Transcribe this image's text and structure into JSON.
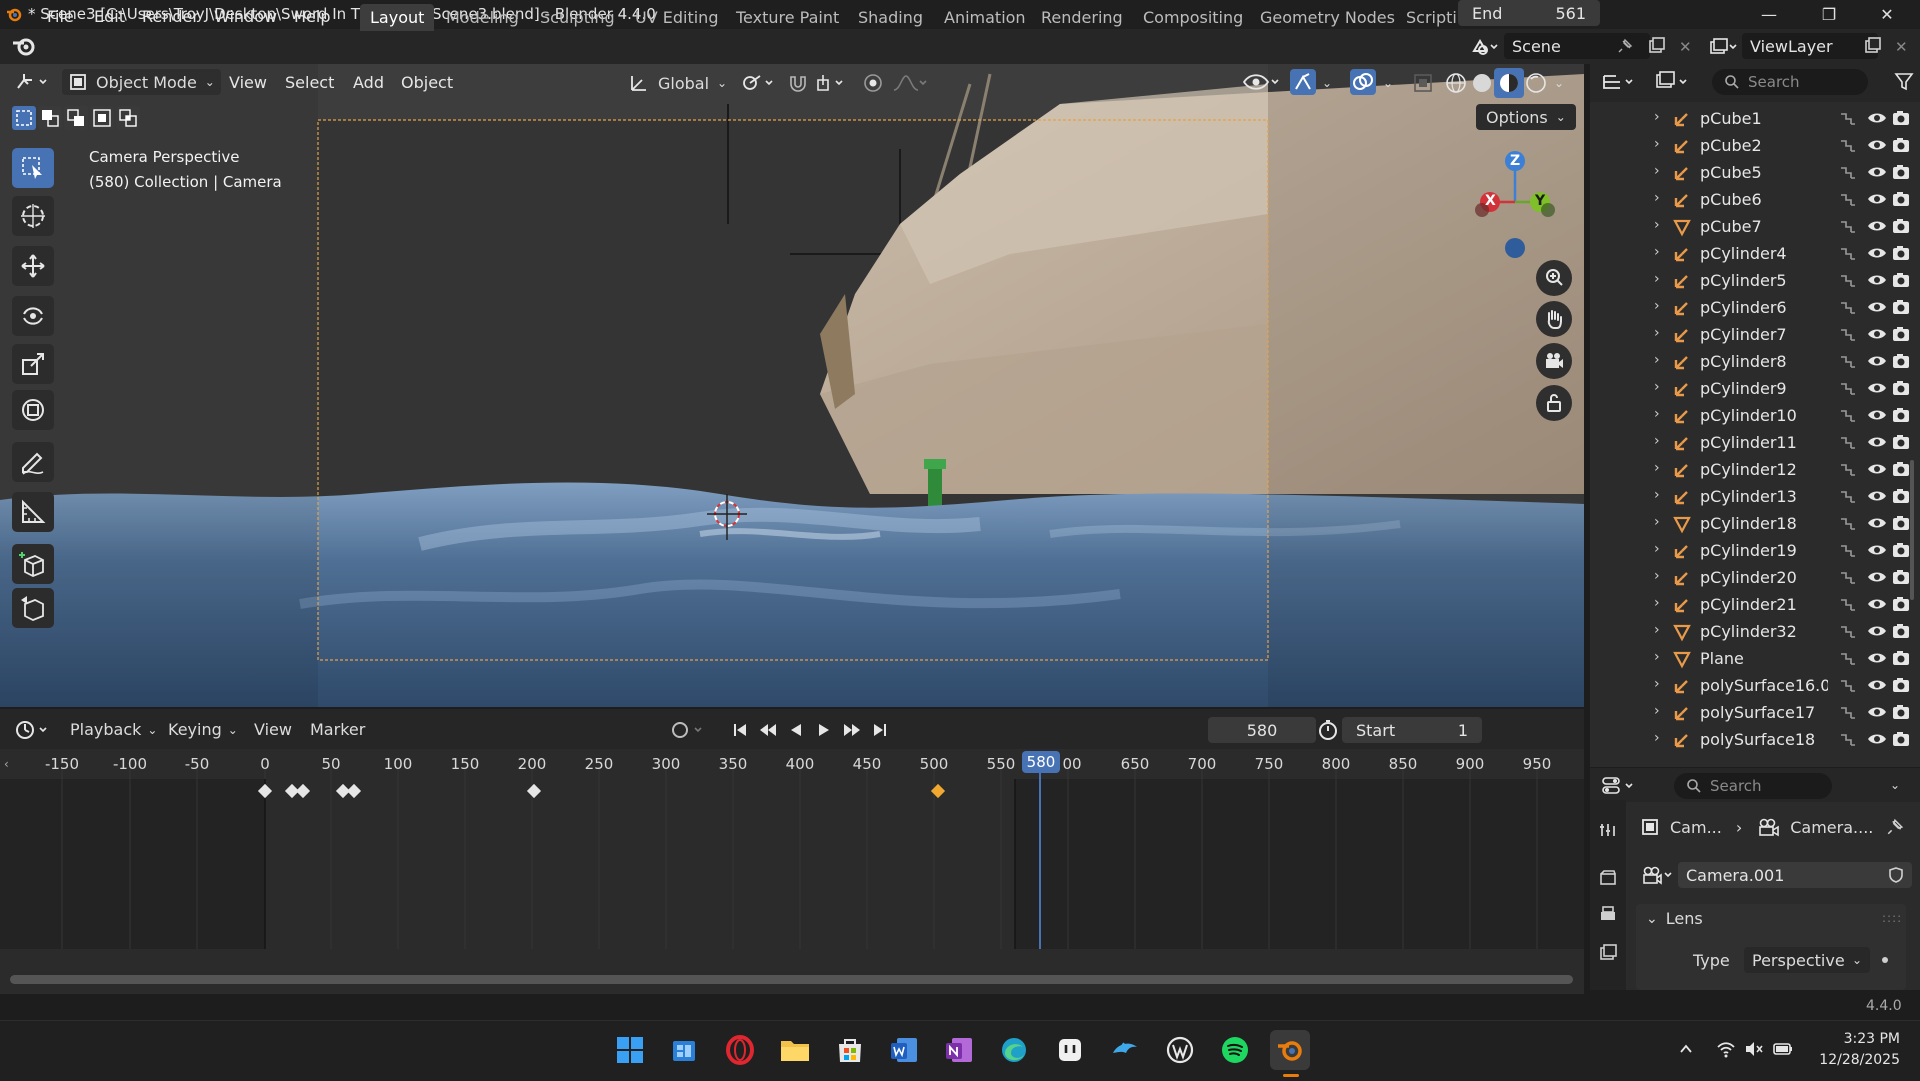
{
  "titlebar": {
    "title": "* Scene3 [C:\\Users\\TroyJ\\Desktop\\Sword In The Stone\\Scene3.blend] - Blender 4.4.0"
  },
  "menu": {
    "file": "File",
    "edit": "Edit",
    "render": "Render",
    "window": "Window",
    "help": "Help"
  },
  "workspaces": [
    {
      "label": "Layout"
    },
    {
      "label": "Modeling"
    },
    {
      "label": "Sculpting"
    },
    {
      "label": "UV Editing"
    },
    {
      "label": "Texture Paint"
    },
    {
      "label": "Shading"
    },
    {
      "label": "Animation"
    },
    {
      "label": "Rendering"
    },
    {
      "label": "Compositing"
    },
    {
      "label": "Geometry Nodes"
    },
    {
      "label": "Scripti"
    }
  ],
  "scene": {
    "name": "Scene",
    "view_layer": "ViewLayer"
  },
  "viewport": {
    "mode": "Object Mode",
    "menus": {
      "view": "View",
      "select": "Select",
      "add": "Add",
      "object": "Object"
    },
    "transform_orientation": "Global",
    "options": "Options",
    "overlay_line1": "Camera Perspective",
    "overlay_line2": "(580) Collection | Camera",
    "gizmo": {
      "x": "X",
      "y": "Y",
      "z": "Z"
    }
  },
  "timeline": {
    "menus": {
      "playback": "Playback",
      "keying": "Keying",
      "view": "View",
      "marker": "Marker"
    },
    "current_frame": "580",
    "start_label": "Start",
    "start_value": "1",
    "end_label": "End",
    "end_value": "561",
    "ticks": [
      "-150",
      "-100",
      "-50",
      "0",
      "50",
      "100",
      "150",
      "200",
      "250",
      "300",
      "350",
      "400",
      "450",
      "500",
      "550",
      "00",
      "650",
      "700",
      "750",
      "800",
      "850",
      "900",
      "950"
    ],
    "playhead_label": "580"
  },
  "outliner": {
    "search_placeholder": "Search",
    "items": [
      {
        "name": "pCube1",
        "kind": "empty"
      },
      {
        "name": "pCube2",
        "kind": "empty"
      },
      {
        "name": "pCube5",
        "kind": "empty"
      },
      {
        "name": "pCube6",
        "kind": "empty"
      },
      {
        "name": "pCube7",
        "kind": "mesh"
      },
      {
        "name": "pCylinder4",
        "kind": "empty"
      },
      {
        "name": "pCylinder5",
        "kind": "empty"
      },
      {
        "name": "pCylinder6",
        "kind": "empty"
      },
      {
        "name": "pCylinder7",
        "kind": "empty"
      },
      {
        "name": "pCylinder8",
        "kind": "empty"
      },
      {
        "name": "pCylinder9",
        "kind": "empty"
      },
      {
        "name": "pCylinder10",
        "kind": "empty"
      },
      {
        "name": "pCylinder11",
        "kind": "empty"
      },
      {
        "name": "pCylinder12",
        "kind": "empty"
      },
      {
        "name": "pCylinder13",
        "kind": "empty"
      },
      {
        "name": "pCylinder18",
        "kind": "mesh"
      },
      {
        "name": "pCylinder19",
        "kind": "empty"
      },
      {
        "name": "pCylinder20",
        "kind": "empty"
      },
      {
        "name": "pCylinder21",
        "kind": "empty"
      },
      {
        "name": "pCylinder32",
        "kind": "mesh"
      },
      {
        "name": "Plane",
        "kind": "mesh"
      },
      {
        "name": "polySurface16.0(",
        "kind": "empty"
      },
      {
        "name": "polySurface17",
        "kind": "empty"
      },
      {
        "name": "polySurface18",
        "kind": "empty"
      }
    ]
  },
  "properties": {
    "search_placeholder": "Search",
    "breadcrumb_object": "Cam...",
    "breadcrumb_data": "Camera....",
    "datablock": "Camera.001",
    "lens_panel": "Lens",
    "type_label": "Type",
    "type_value": "Perspective"
  },
  "status": {
    "version": "4.4.0"
  },
  "taskbar": {
    "time": "3:23 PM",
    "date": "12/28/2025"
  },
  "colors": {
    "accent": "#4772b3",
    "blender_orange": "#e87d0d",
    "keyframe_selected": "#f0a830",
    "empty_icon": "#e89a4a"
  }
}
